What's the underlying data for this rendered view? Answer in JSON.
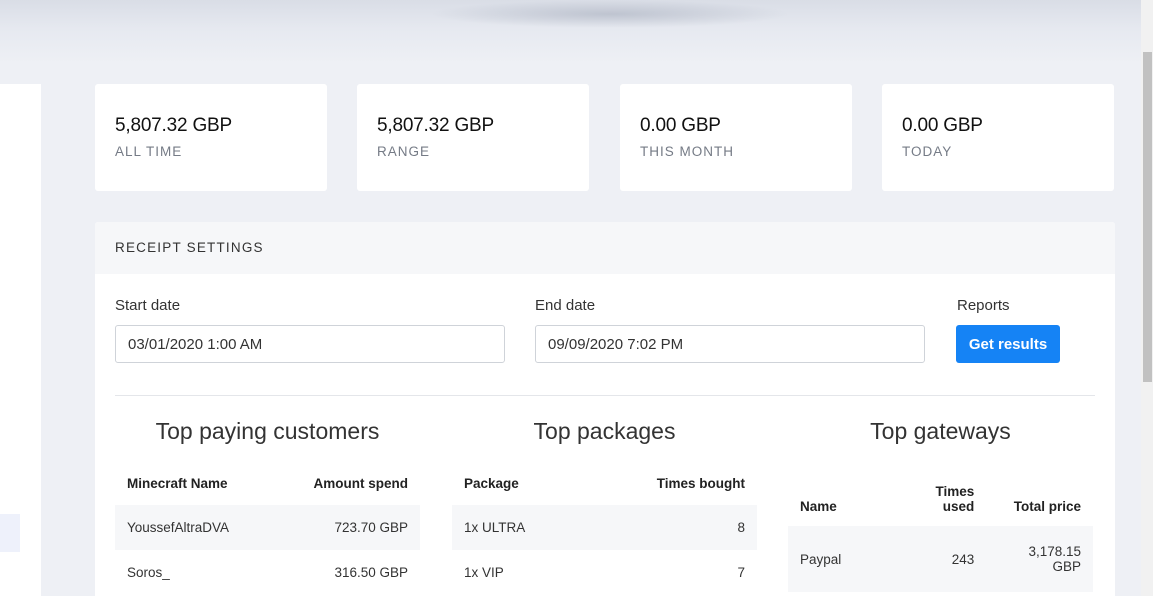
{
  "stats": [
    {
      "value": "5,807.32 GBP",
      "label": "ALL TIME"
    },
    {
      "value": "5,807.32 GBP",
      "label": "RANGE"
    },
    {
      "value": "0.00 GBP",
      "label": "THIS MONTH"
    },
    {
      "value": "0.00 GBP",
      "label": "TODAY"
    }
  ],
  "receipt": {
    "title": "RECEIPT SETTINGS",
    "start_label": "Start date",
    "start_value": "03/01/2020 1:00 AM",
    "end_label": "End date",
    "end_value": "09/09/2020 7:02 PM",
    "reports_label": "Reports",
    "button_label": "Get results"
  },
  "customers": {
    "title": "Top paying customers",
    "headers": [
      "Minecraft Name",
      "Amount spend"
    ],
    "rows": [
      [
        "YoussefAltraDVA",
        "723.70 GBP"
      ],
      [
        "Soros_",
        "316.50 GBP"
      ]
    ]
  },
  "packages": {
    "title": "Top packages",
    "headers": [
      "Package",
      "Times bought"
    ],
    "rows": [
      [
        "1x ULTRA",
        "8"
      ],
      [
        "1x VIP",
        "7"
      ]
    ]
  },
  "gateways": {
    "title": "Top gateways",
    "headers": [
      "Name",
      "Times used",
      "Total price"
    ],
    "rows": [
      [
        "Paypal",
        "243",
        "3,178.15 GBP"
      ]
    ]
  }
}
